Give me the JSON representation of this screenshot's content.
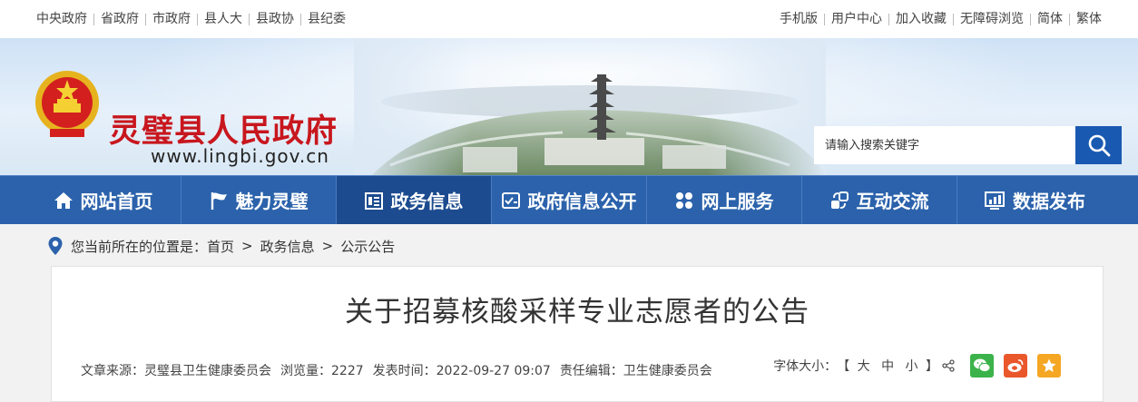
{
  "topbar": {
    "left_links": [
      "中央政府",
      "省政府",
      "市政府",
      "县人大",
      "县政协",
      "县纪委"
    ],
    "right_links": [
      "手机版",
      "用户中心",
      "加入收藏",
      "无障碍浏览",
      "简体",
      "繁体"
    ]
  },
  "banner": {
    "site_name": "灵璧县人民政府",
    "site_url": "www.lingbi.gov.cn",
    "search_placeholder": "请输入搜索关键字"
  },
  "nav": [
    {
      "label": "网站首页",
      "icon": "home-icon"
    },
    {
      "label": "魅力灵璧",
      "icon": "flag-icon"
    },
    {
      "label": "政务信息",
      "icon": "news-icon"
    },
    {
      "label": "政府信息公开",
      "icon": "info-board-icon"
    },
    {
      "label": "网上服务",
      "icon": "grid-icon"
    },
    {
      "label": "互动交流",
      "icon": "exchange-icon"
    },
    {
      "label": "数据发布",
      "icon": "chart-icon"
    }
  ],
  "breadcrumb": {
    "prefix": "您当前所在的位置是：",
    "items": [
      "首页",
      "政务信息",
      "公示公告"
    ]
  },
  "article": {
    "title": "关于招募核酸采样专业志愿者的公告",
    "source": "文章来源：灵璧县卫生健康委员会",
    "views": "浏览量：2227",
    "date": "发表时间：2022-09-27 09:07",
    "editor": "责任编辑：卫生健康委员会",
    "font_size_label": "字体大小：",
    "size_open": "【",
    "size_large": "大",
    "size_medium": "中",
    "size_small": "小",
    "size_close": "】"
  },
  "colors": {
    "nav_bg": "#2b62ab",
    "nav_active": "#1c4b8f",
    "brand_red": "#c8161d",
    "wechat": "#3bb34a",
    "weibo": "#e9572b",
    "favorite": "#f5a623"
  }
}
